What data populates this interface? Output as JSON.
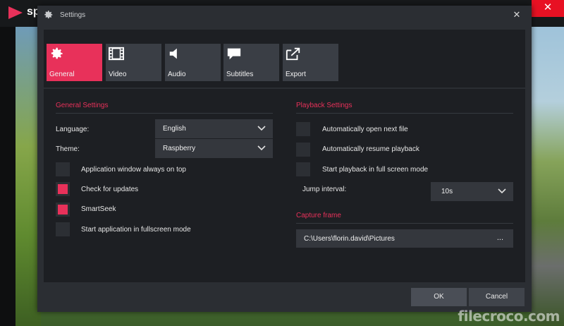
{
  "player": {
    "brand": "sp",
    "close_glyph": "✕",
    "colors": {
      "accent": "#e8315a",
      "panel": "#1d1f23",
      "dialog": "#2b2e33"
    }
  },
  "dialog": {
    "title": "Settings",
    "close_glyph": "✕",
    "tabs": [
      {
        "label": "General",
        "icon": "gear-icon",
        "active": true
      },
      {
        "label": "Video",
        "icon": "film-icon",
        "active": false
      },
      {
        "label": "Audio",
        "icon": "speaker-icon",
        "active": false
      },
      {
        "label": "Subtitles",
        "icon": "speech-bubble-icon",
        "active": false
      },
      {
        "label": "Export",
        "icon": "export-icon",
        "active": false
      }
    ],
    "general": {
      "title": "General Settings",
      "language_label": "Language:",
      "language_value": "English",
      "theme_label": "Theme:",
      "theme_value": "Raspberry",
      "options": [
        {
          "label": "Application window always on top",
          "checked": false
        },
        {
          "label": "Check for updates",
          "checked": true
        },
        {
          "label": "SmartSeek",
          "checked": true
        },
        {
          "label": "Start application in fullscreen mode",
          "checked": false
        }
      ]
    },
    "playback": {
      "title": "Playback Settings",
      "options": [
        {
          "label": "Automatically open next file",
          "checked": false
        },
        {
          "label": "Automatically resume playback",
          "checked": false
        },
        {
          "label": "Start playback in full screen mode",
          "checked": false
        }
      ],
      "jump_label": "Jump interval:",
      "jump_value": "10s"
    },
    "capture": {
      "title": "Capture frame",
      "path": "C:\\Users\\florin.david\\Pictures",
      "browse": "..."
    },
    "buttons": {
      "ok": "OK",
      "cancel": "Cancel"
    }
  },
  "watermark": "filecroco.com"
}
